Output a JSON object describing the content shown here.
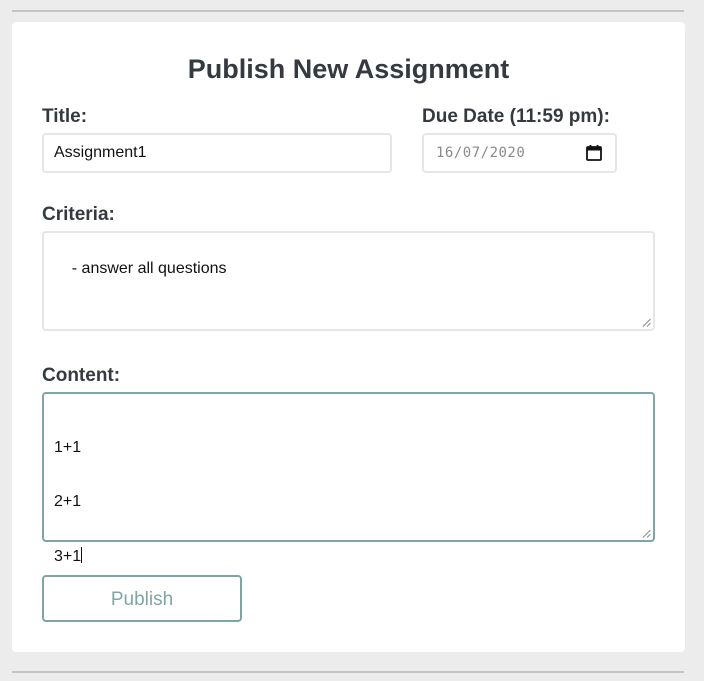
{
  "form": {
    "heading": "Publish New Assignment",
    "title_label": "Title:",
    "title_value": "Assignment1",
    "due_label": "Due Date (11:59 pm):",
    "due_value": "16/07/2020",
    "criteria_label": "Criteria:",
    "criteria_value": "- answer all questions",
    "content_label": "Content:",
    "content_lines": [
      "1+1",
      "2+1",
      "3+1"
    ],
    "publish_label": "Publish"
  },
  "colors": {
    "accent": "#7fa6a6",
    "text": "#343a40",
    "background": "#ececec",
    "card": "#ffffff",
    "input_border": "#e6e6e6"
  },
  "icons": {
    "date_picker": "calendar-icon",
    "resize": "resize-grip-icon"
  }
}
